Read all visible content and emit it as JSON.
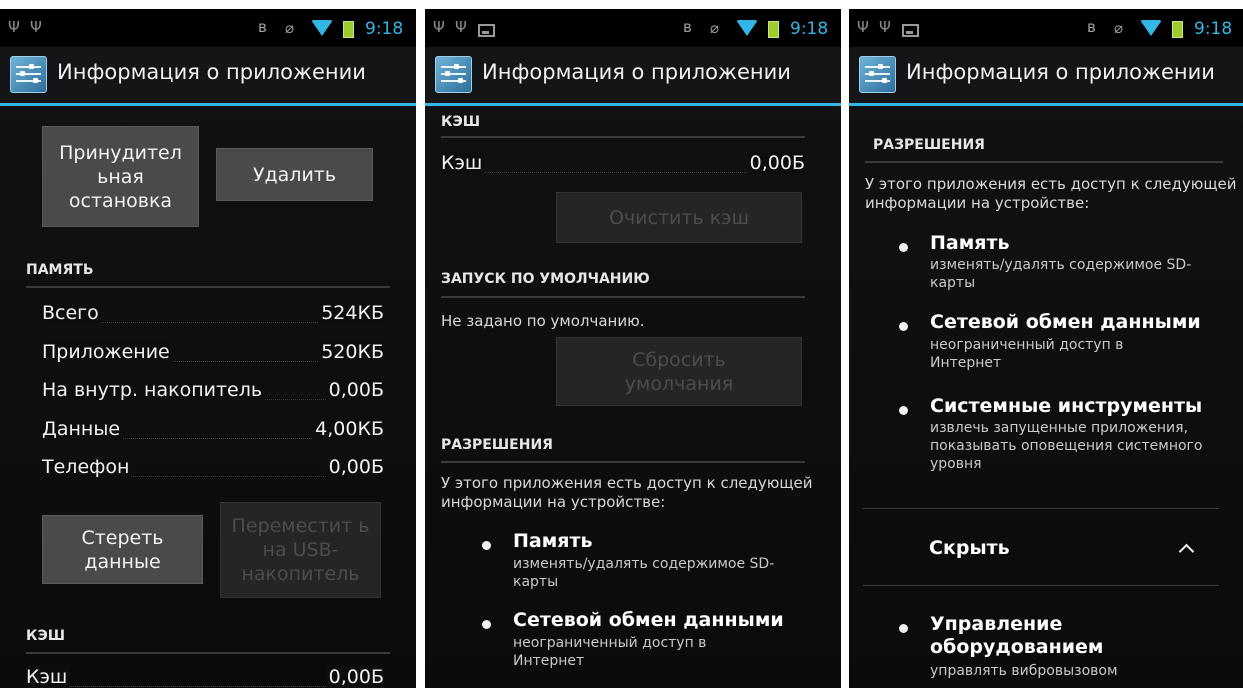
{
  "status_bar": {
    "time": "9:18"
  },
  "title": "Информация о приложении",
  "screen1": {
    "force_stop": "Принудител ьная остановка",
    "uninstall": "Удалить",
    "memory_header": "ПАМЯТЬ",
    "rows": [
      {
        "label": "Всего",
        "value": "524КБ"
      },
      {
        "label": "Приложение",
        "value": "520КБ"
      },
      {
        "label": "На внутр. накопитель",
        "value": "0,00Б"
      },
      {
        "label": "Данные",
        "value": "4,00КБ"
      },
      {
        "label": "Телефон",
        "value": "0,00Б"
      }
    ],
    "clear_data": "Стереть данные",
    "move_usb": "Переместит ь на USB-накопитель",
    "cache_header": "КЭШ",
    "cache_label": "Кэш",
    "cache_value": "0,00Б"
  },
  "screen2": {
    "cache_header": "КЭШ",
    "cache_label": "Кэш",
    "cache_value": "0,00Б",
    "clear_cache": "Очистить кэш",
    "launch_header": "ЗАПУСК ПО УМОЛЧАНИЮ",
    "launch_text": "Не задано по умолчанию.",
    "reset_defaults": "Сбросить умолчания",
    "perm_header": "РАЗРЕШЕНИЯ",
    "perm_intro": "У этого приложения есть доступ к следующей информации на устройстве:",
    "perms": [
      {
        "title": "Память",
        "desc": "изменять/удалять содержимое SD-карты"
      },
      {
        "title": "Сетевой обмен данными",
        "desc": "неограниченный доступ в Интернет"
      }
    ]
  },
  "screen3": {
    "perm_header": "РАЗРЕШЕНИЯ",
    "perm_intro": "У этого приложения есть доступ к следующей информации на устройстве:",
    "perms": [
      {
        "title": "Память",
        "desc": "изменять/удалять содержимое SD-карты"
      },
      {
        "title": "Сетевой обмен данными",
        "desc": "неограниченный доступ в Интернет"
      },
      {
        "title": "Системные инструменты",
        "desc": "извлечь запущенные приложения, показывать оповещения системного уровня"
      }
    ],
    "hide_label": "Скрыть",
    "extra_perm": {
      "title": "Управление оборудованием",
      "desc": "управлять вибровызовом"
    }
  }
}
